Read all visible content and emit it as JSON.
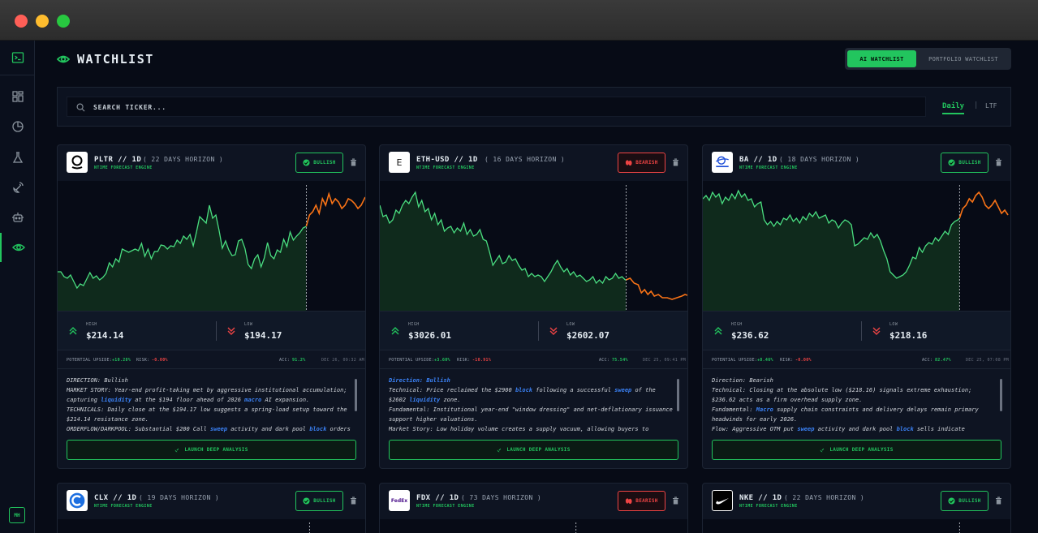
{
  "page": {
    "title": "WATCHLIST",
    "tabs": [
      "AI WATCHLIST",
      "PORTFOLIO WATCHLIST"
    ],
    "search_placeholder": "SEARCH TICKER...",
    "timeframes": [
      "Daily",
      "LTF"
    ],
    "user_initials": "MH"
  },
  "colors": {
    "accent": "#22c55e",
    "bearish": "#ef4444",
    "forecast": "#f97316",
    "highlight": "#3b82f6",
    "background": "#070b16"
  },
  "sidebar_icons": [
    "terminal-icon",
    "dashboard-icon",
    "pie-chart-icon",
    "flask-icon",
    "satellite-icon",
    "robot-icon",
    "eye-icon"
  ],
  "cards": [
    {
      "ticker": "PLTR // 1D",
      "horizon": "( 22 DAYS HORIZON )",
      "engine": "NTIME FORECAST ENGINE",
      "sentiment": "BULLISH",
      "logo": "pltr-logo",
      "high_label": "HIGH",
      "high": "$214.14",
      "low_label": "LOW",
      "low": "$194.17",
      "upside_label": "POTENTIAL UPSIDE:",
      "upside": "+10.28%",
      "risk_label": "RISK:",
      "risk": "-0.00%",
      "acc_label": "ACC:",
      "acc": "91.2%",
      "date": "DEC 26, 09:32 AM",
      "story": [
        "DIRECTION: Bullish",
        "MARKET STORY: Year-end profit-taking met by aggressive institutional accumulation; capturing liquidity at the $194 floor ahead of 2026 macro AI expansion.",
        "TECHNICALS: Daily close at the $194.17 low suggests a spring-load setup toward the $214.14 resistance zone.",
        "ORDERFLOW/DARKPOOL: Substantial $200 Call sweep activity and dark pool block orders"
      ],
      "launch_label": "LAUNCH DEEP ANALYSIS"
    },
    {
      "ticker": "ETH-USD // 1D",
      "horizon": "( 16 DAYS HORIZON )",
      "engine": "NTIME FORECAST ENGINE",
      "sentiment": "BEARISH",
      "logo": "eth-logo",
      "logo_letter": "E",
      "high_label": "HIGH",
      "high": "$3026.01",
      "low_label": "LOW",
      "low": "$2602.07",
      "upside_label": "POTENTIAL UPSIDE:",
      "upside": "+3.60%",
      "risk_label": "RISK:",
      "risk": "-10.91%",
      "acc_label": "ACC:",
      "acc": "75.54%",
      "date": "DEC 25, 09:41 PM",
      "story": [
        "Direction: Bullish",
        "Technical: Price reclaimed the $2900 block following a successful sweep of the $2602 liquidity zone.",
        "Fundamental: Institutional year-end \"window dressing\" and net-deflationary issuance support higher valuations.",
        "Market Story: Low holiday volume creates a supply vacuum, allowing buyers to dominate"
      ],
      "launch_label": "LAUNCH DEEP ANALYSIS"
    },
    {
      "ticker": "BA // 1D",
      "horizon": "( 18 DAYS HORIZON )",
      "engine": "NTIME FORECAST ENGINE",
      "sentiment": "BULLISH",
      "logo": "boeing-logo",
      "high_label": "HIGH",
      "high": "$236.62",
      "low_label": "LOW",
      "low": "$218.16",
      "upside_label": "POTENTIAL UPSIDE:",
      "upside": "+8.46%",
      "risk_label": "RISK:",
      "risk": "-0.00%",
      "acc_label": "ACC:",
      "acc": "82.47%",
      "date": "DEC 25, 07:08 PM",
      "story": [
        "Direction: Bearish",
        "Technical: Closing at the absolute low ($218.16) signals extreme exhaustion; $236.62 acts as a firm overhead supply zone.",
        "Fundamental: Macro supply chain constraints and delivery delays remain primary headwinds for early 2026.",
        "Flow: Aggressive OTM put sweep activity and dark pool block sells indicate"
      ],
      "launch_label": "LAUNCH DEEP ANALYSIS"
    },
    {
      "ticker": "CLX // 1D",
      "horizon": "( 19 DAYS HORIZON )",
      "engine": "NTIME FORECAST ENGINE",
      "sentiment": "BULLISH",
      "logo": "clx-logo"
    },
    {
      "ticker": "FDX // 1D",
      "horizon": "( 73 DAYS HORIZON )",
      "engine": "NTIME FORECAST ENGINE",
      "sentiment": "BEARISH",
      "logo": "fedex-logo",
      "logo_text": "FedEx"
    },
    {
      "ticker": "NKE // 1D",
      "horizon": "( 22 DAYS HORIZON )",
      "engine": "NTIME FORECAST ENGINE",
      "sentiment": "BULLISH",
      "logo": "nike-logo"
    }
  ]
}
